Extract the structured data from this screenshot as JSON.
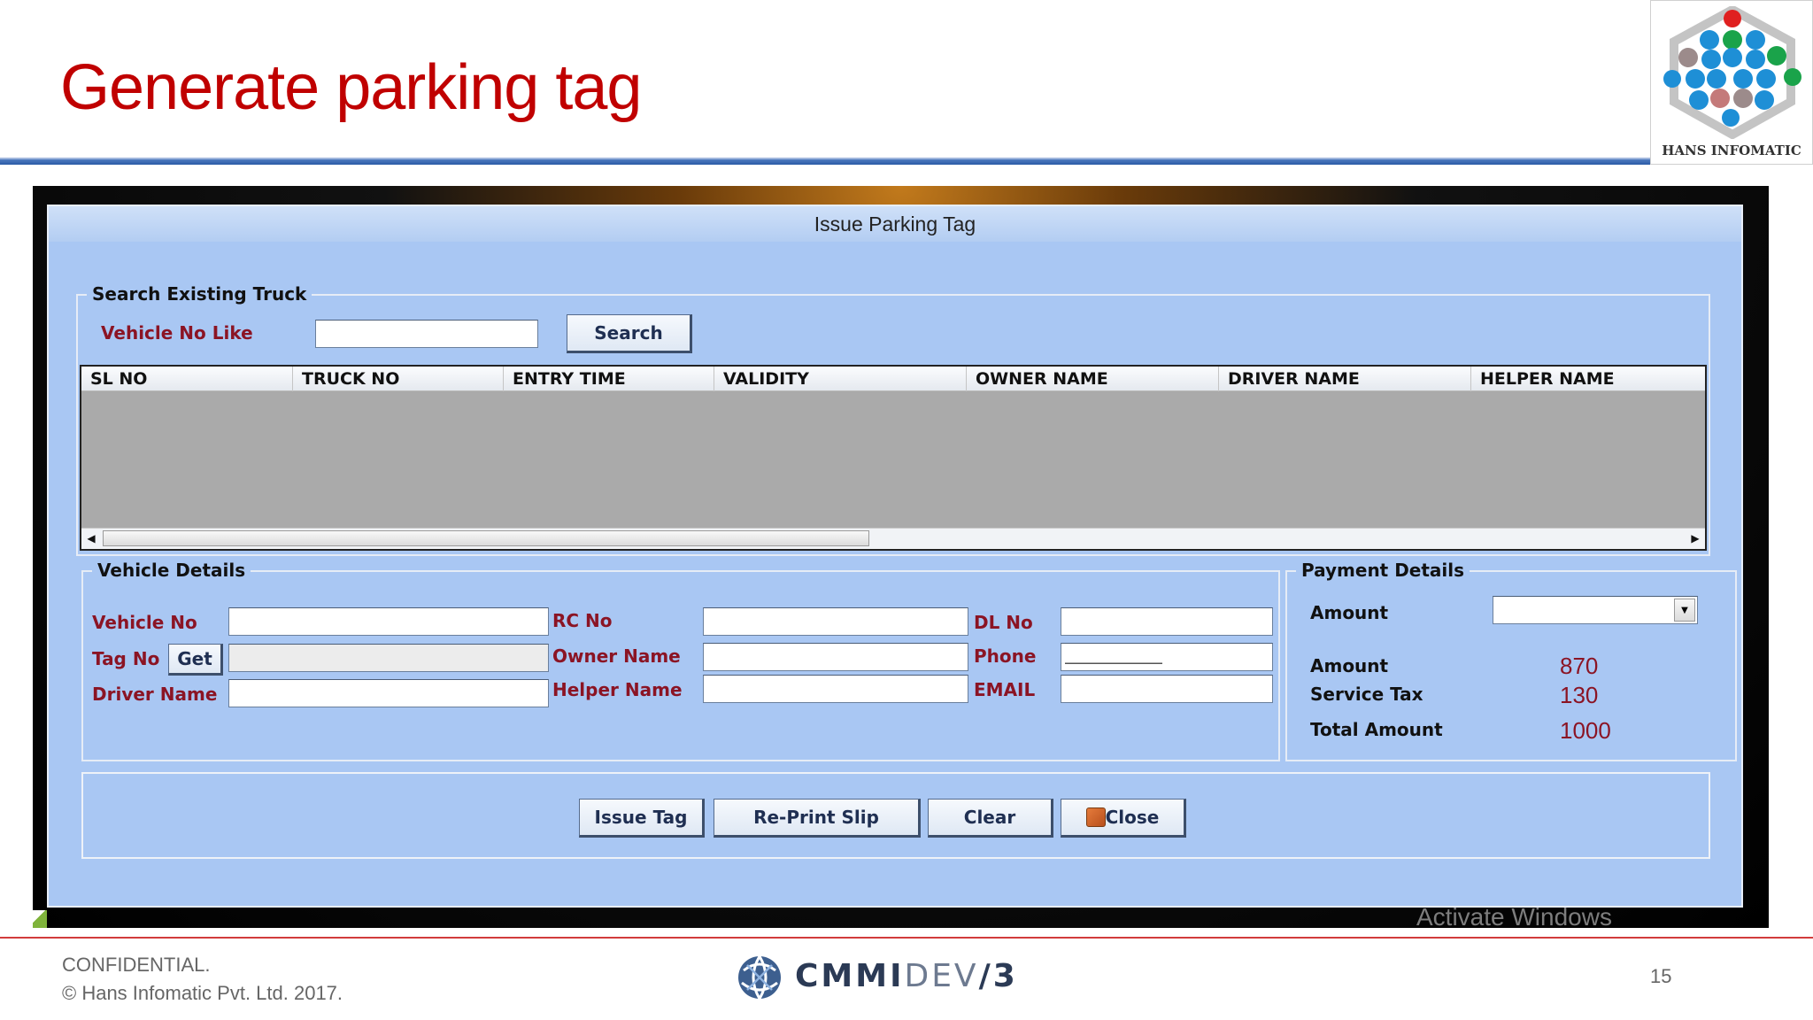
{
  "slide": {
    "title": "Generate parking tag",
    "logo_text": "HANS INFOMATIC",
    "footer_line1": "CONFIDENTIAL.",
    "footer_line2": "© Hans Infomatic Pvt. Ltd. 2017.",
    "cmmi_brand": "CMMI",
    "cmmi_suffix": "DEV",
    "cmmi_level": "/3",
    "page_number": "15",
    "watermark": "Activate Windows"
  },
  "window": {
    "title": "Issue Parking Tag"
  },
  "search": {
    "legend": "Search Existing Truck",
    "vehicle_label": "Vehicle No Like",
    "vehicle_value": "",
    "search_button": "Search"
  },
  "grid": {
    "columns": [
      "SL NO",
      "TRUCK NO",
      "ENTRY TIME",
      "VALIDITY",
      "OWNER NAME",
      "DRIVER NAME",
      "HELPER NAME"
    ],
    "rows": []
  },
  "vehicle_details": {
    "legend": "Vehicle Details",
    "vehicle_no_label": "Vehicle No",
    "tag_no_label": "Tag No",
    "get_button": "Get",
    "driver_name_label": "Driver Name",
    "rc_no_label": "RC No",
    "owner_name_label": "Owner Name",
    "helper_name_label": "Helper Name",
    "dl_no_label": "DL No",
    "phone_label": "Phone",
    "email_label": "EMAIL"
  },
  "payment_details": {
    "legend": "Payment Details",
    "amount_select_label": "Amount",
    "amount_selected": "",
    "amount_label": "Amount",
    "amount_value": "870",
    "service_tax_label": "Service Tax",
    "service_tax_value": "130",
    "total_label": "Total Amount",
    "total_value": "1000"
  },
  "actions": {
    "issue_tag": "Issue Tag",
    "reprint_slip": "Re-Print Slip",
    "clear": "Clear",
    "close": "Close"
  },
  "colors": {
    "title_red": "#c00000",
    "label_maroon": "#8b1424",
    "window_bg": "#a9c7f3"
  }
}
